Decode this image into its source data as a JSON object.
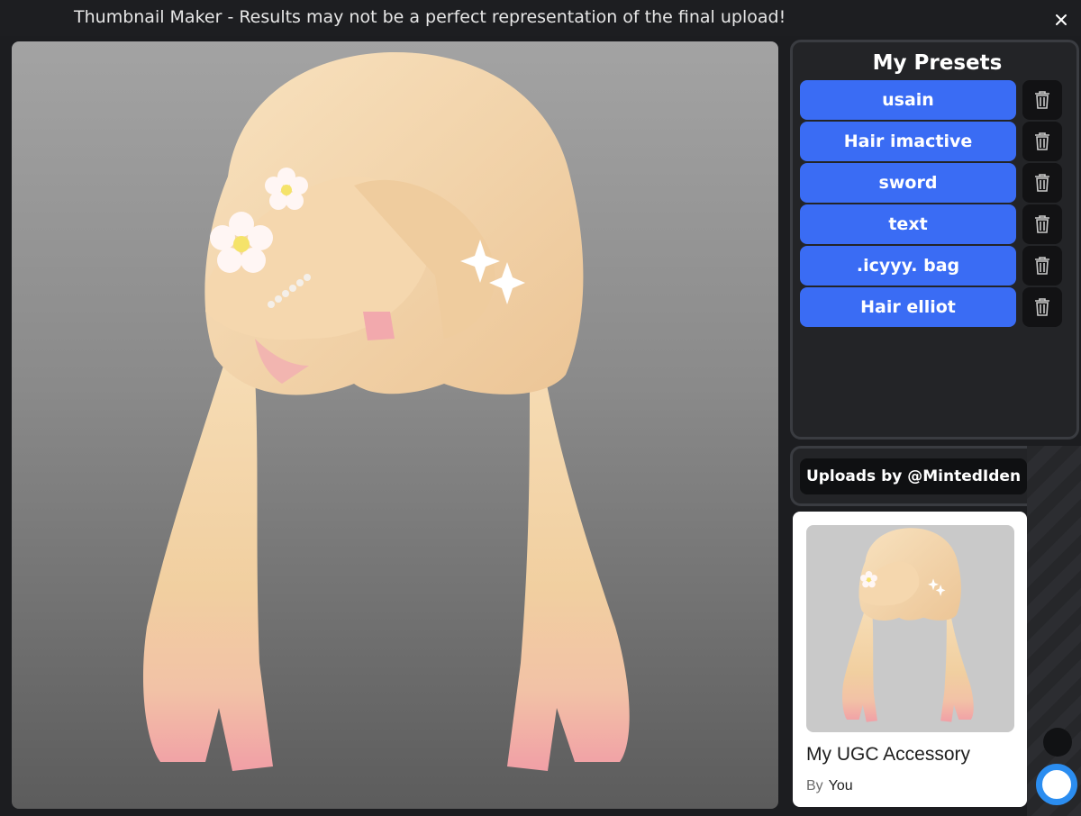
{
  "window": {
    "title": "Thumbnail Maker - Results may not be a perfect representation of the final upload!"
  },
  "presets": {
    "title": "My Presets",
    "items": [
      {
        "label": "usain"
      },
      {
        "label": "Hair imactive"
      },
      {
        "label": "sword"
      },
      {
        "label": "text"
      },
      {
        "label": ".icyyy. bag"
      },
      {
        "label": "Hair elliot"
      }
    ]
  },
  "uploads": {
    "label": "Uploads by @MintedIden"
  },
  "card": {
    "name": "My UGC Accessory",
    "by_label": "By",
    "author": "You"
  },
  "colors": {
    "accent_blue": "#3a6cf4",
    "panel_border": "#3a3c41",
    "hair_light": "#f3d2a6",
    "hair_tip_pink": "#f4a9a8"
  },
  "icons": {
    "close": "close-icon",
    "trash": "trash-icon",
    "save": "save-icon"
  }
}
